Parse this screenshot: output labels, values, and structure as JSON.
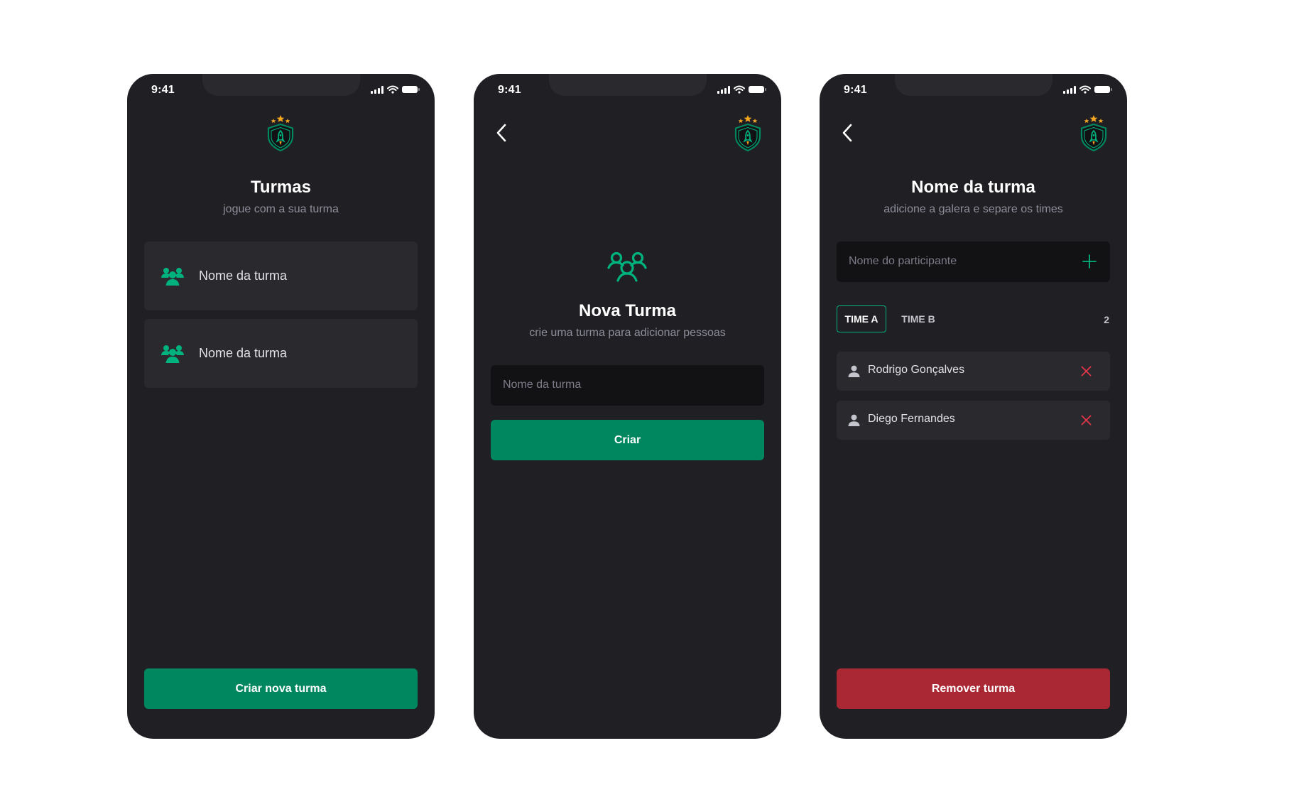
{
  "status_bar": {
    "time": "9:41"
  },
  "screen_groups": {
    "title": "Turmas",
    "subtitle": "jogue com a sua turma",
    "groups": [
      {
        "label": "Nome da turma"
      },
      {
        "label": "Nome da turma"
      }
    ],
    "primary_button": "Criar nova turma"
  },
  "screen_new_group": {
    "title": "Nova Turma",
    "subtitle": "crie uma turma para adicionar pessoas",
    "input_placeholder": "Nome da turma",
    "primary_button": "Criar"
  },
  "screen_players": {
    "title": "Nome da turma",
    "subtitle": "adicione a galera e separe os times",
    "input_placeholder": "Nome do participante",
    "tabs": [
      {
        "label": "TIME A",
        "active": true
      },
      {
        "label": "TIME B",
        "active": false
      }
    ],
    "player_count": "2",
    "players": [
      {
        "name": "Rodrigo Gonçalves"
      },
      {
        "name": "Diego Fernandes"
      }
    ],
    "danger_button": "Remover turma"
  },
  "icons": {
    "logo": "shield-rocket-logo-icon",
    "group": "users-three-icon",
    "back": "caret-left-icon",
    "add": "plus-icon",
    "person": "user-icon",
    "remove": "x-close-icon"
  },
  "colors": {
    "background": "#202024",
    "card": "#29292e",
    "input": "#121214",
    "accent_green": "#00875f",
    "icon_green": "#00b37e",
    "danger_red": "#aa2834",
    "text_secondary": "#8d8d99",
    "star_orange": "#f5a623"
  }
}
